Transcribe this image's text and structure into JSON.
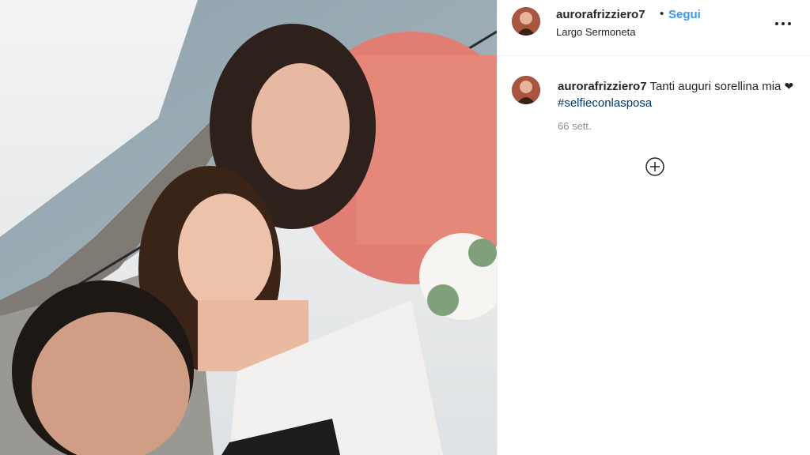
{
  "post": {
    "username": "aurorafrizziero7",
    "separator": "•",
    "follow_label": "Segui",
    "location": "Largo Sermoneta",
    "more_icon": "more-options-icon"
  },
  "comment": {
    "username": "aurorafrizziero7",
    "text": "Tanti auguri sorellina mia",
    "heart": "❤",
    "hashtag": "#selfieconlasposa",
    "time": "66 sett."
  },
  "icons": {
    "load_more": "add-circle-icon"
  },
  "colors": {
    "link_blue": "#3897f0",
    "hashtag": "#00376b",
    "muted": "#8e8e8e",
    "divider": "#efefef"
  }
}
